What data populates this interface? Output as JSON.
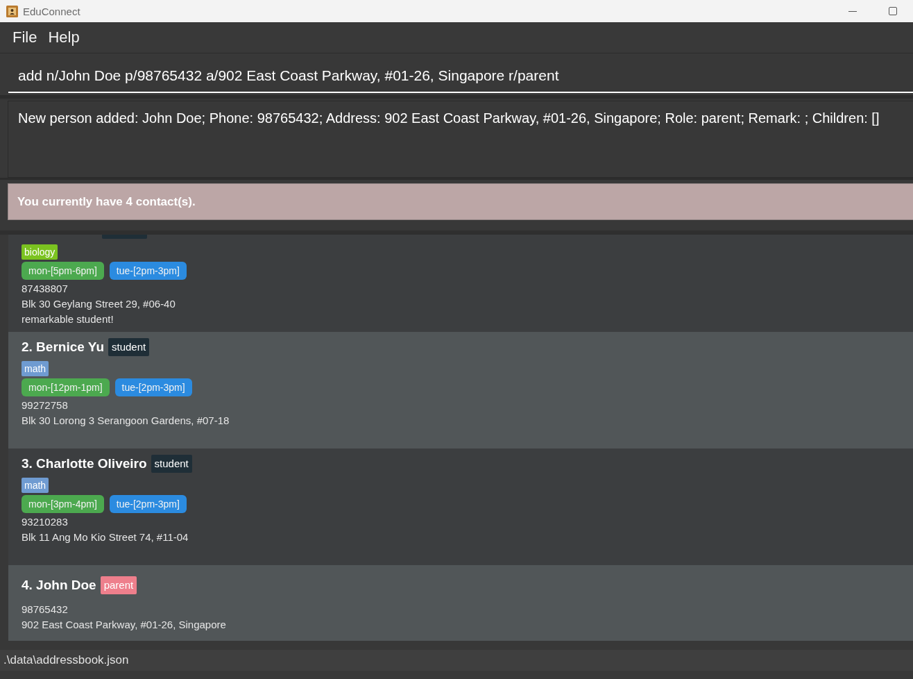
{
  "window": {
    "title": "EduConnect"
  },
  "menu": [
    {
      "label": "File"
    },
    {
      "label": "Help"
    }
  ],
  "command_box": {
    "value": "add n/John Doe p/98765432 a/902 East Coast Parkway, #01-26, Singapore r/parent"
  },
  "result_display": {
    "text": "New person added: John Doe; Phone: 98765432; Address: 902 East Coast Parkway, #01-26, Singapore; Role: parent; Remark: ; Children: []"
  },
  "summary": {
    "text": "You currently have 4 contact(s)."
  },
  "persons": [
    {
      "cut_off": true,
      "role": {
        "color": "#1f2e37"
      },
      "subjects": [
        {
          "label": "biology",
          "color": "#7bc320"
        }
      ],
      "schedules": [
        {
          "label": "mon-[5pm-6pm]",
          "color": "#4ca94f"
        },
        {
          "label": "tue-[2pm-3pm]",
          "color": "#2b8be0"
        }
      ],
      "phone": "87438807",
      "address": "Blk 30 Geylang Street 29, #06-40",
      "remark": "remarkable student!"
    },
    {
      "cut_off": false,
      "name": "2. Bernice Yu",
      "role": {
        "label": "student",
        "color": "#1f2e37"
      },
      "subjects": [
        {
          "label": "math",
          "color": "#6f9bd1"
        }
      ],
      "schedules": [
        {
          "label": "mon-[12pm-1pm]",
          "color": "#4ca94f"
        },
        {
          "label": "tue-[2pm-3pm]",
          "color": "#2b8be0"
        }
      ],
      "phone": "99272758",
      "address": "Blk 30 Lorong 3 Serangoon Gardens, #07-18"
    },
    {
      "cut_off": false,
      "name": "3. Charlotte Oliveiro",
      "role": {
        "label": "student",
        "color": "#1f2e37"
      },
      "subjects": [
        {
          "label": "math",
          "color": "#6f9bd1"
        }
      ],
      "schedules": [
        {
          "label": "mon-[3pm-4pm]",
          "color": "#4ca94f"
        },
        {
          "label": "tue-[2pm-3pm]",
          "color": "#2b8be0"
        }
      ],
      "phone": "93210283",
      "address": "Blk 11 Ang Mo Kio Street 74, #11-04"
    },
    {
      "cut_off": false,
      "name": "4. John Doe",
      "role": {
        "label": "parent",
        "color": "#ee7f8c"
      },
      "phone": "98765432",
      "address": "902 East Coast Parkway, #01-26, Singapore"
    }
  ],
  "status_bar": {
    "path": ".\\data\\addressbook.json"
  }
}
